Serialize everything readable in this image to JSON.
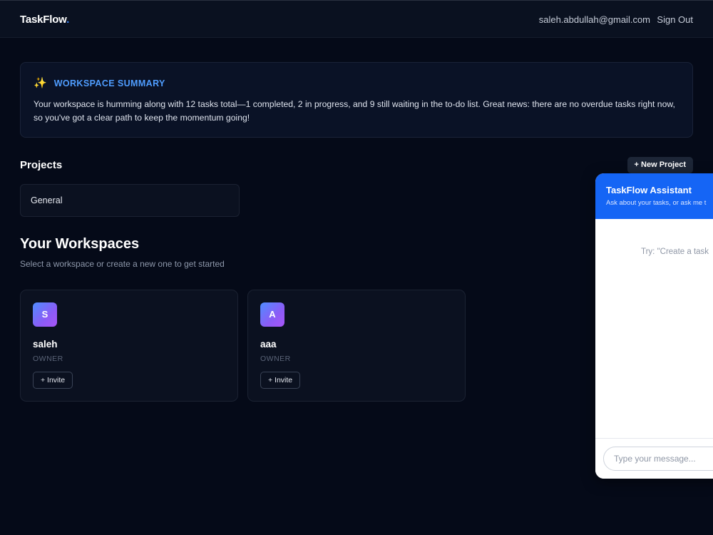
{
  "header": {
    "brand": "TaskFlow",
    "brand_dot": ".",
    "user_email": "saleh.abdullah@gmail.com",
    "sign_out": "Sign Out"
  },
  "summary": {
    "icon": "sparkle-icon",
    "title": "WORKSPACE SUMMARY",
    "text": "Your workspace is humming along with 12 tasks total—1 completed, 2 in progress, and 9 still waiting in the to-do list. Great news: there are no overdue tasks right now, so you've got a clear path to keep the momentum going!"
  },
  "projects": {
    "title": "Projects",
    "new_button": "+ New Project",
    "items": [
      {
        "name": "General"
      }
    ]
  },
  "workspaces": {
    "title": "Your Workspaces",
    "subtitle": "Select a workspace or create a new one to get started",
    "items": [
      {
        "initial": "S",
        "name": "saleh",
        "role": "OWNER",
        "invite": "+ Invite"
      },
      {
        "initial": "A",
        "name": "aaa",
        "role": "OWNER",
        "invite": "+ Invite"
      }
    ]
  },
  "assistant": {
    "title": "TaskFlow Assistant",
    "subtitle": "Ask about your tasks, or ask me t",
    "hint": "Try: \"Create a task",
    "input_placeholder": "Type your message..."
  },
  "colors": {
    "background": "#050a18",
    "accent": "#1565f5",
    "summary_title": "#4f9dff"
  }
}
